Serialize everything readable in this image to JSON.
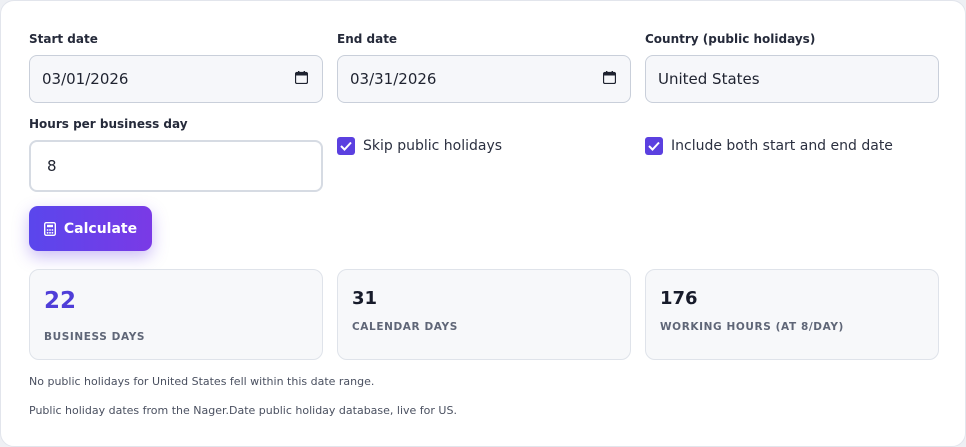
{
  "form": {
    "start_date": {
      "label": "Start date",
      "value": "03/01/2026"
    },
    "end_date": {
      "label": "End date",
      "value": "03/31/2026"
    },
    "country": {
      "label": "Country (public holidays)",
      "value": "United States"
    },
    "hours": {
      "label": "Hours per business day",
      "value": "8"
    },
    "skip_holidays": {
      "label": "Skip public holidays",
      "checked": true
    },
    "include_both": {
      "label": "Include both start and end date",
      "checked": true
    },
    "calculate_label": "Calculate"
  },
  "results": [
    {
      "value": "22",
      "caption": "BUSINESS DAYS"
    },
    {
      "value": "31",
      "caption": "CALENDAR DAYS"
    },
    {
      "value": "176",
      "caption": "WORKING HOURS (AT 8/DAY)"
    }
  ],
  "notes": {
    "holidays": "No public holidays for United States fell within this date range.",
    "source": "Public holiday dates from the Nager.Date public holiday database, live for US."
  },
  "colors": {
    "accent": "#5b40e0",
    "button_start": "#5a46ec",
    "button_end": "#7a3ae6"
  }
}
